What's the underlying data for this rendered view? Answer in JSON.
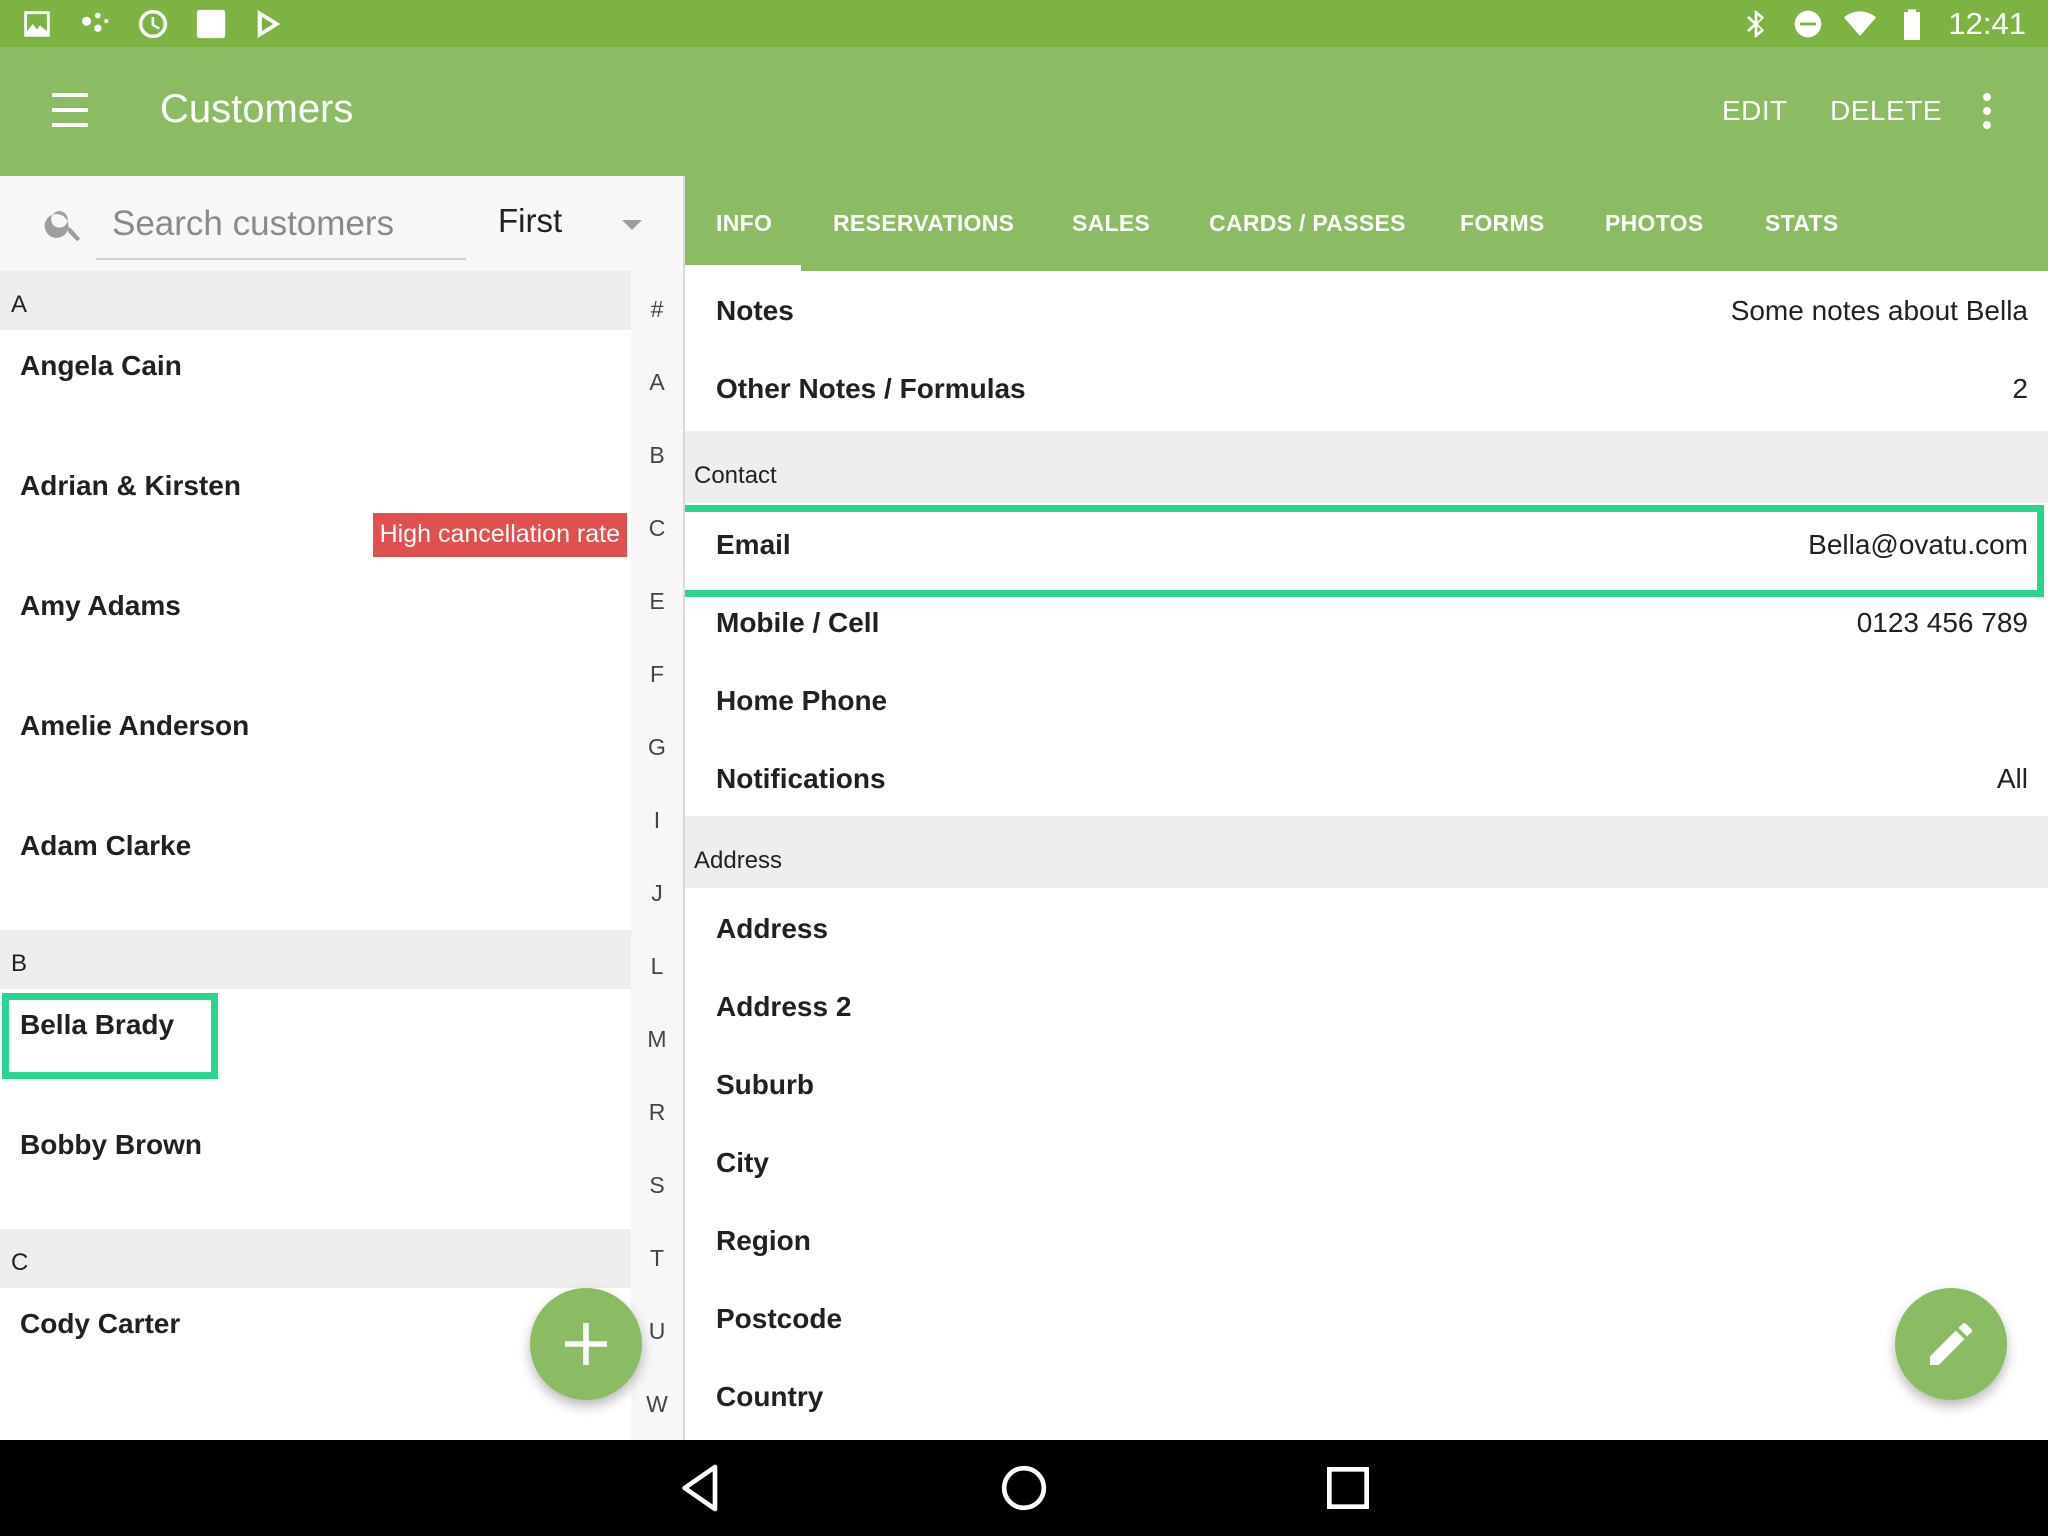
{
  "status_bar": {
    "time": "12:41"
  },
  "app_bar": {
    "title": "Customers",
    "edit_label": "EDIT",
    "delete_label": "DELETE"
  },
  "search": {
    "placeholder": "Search customers",
    "sort_value": "First"
  },
  "customer_list": {
    "sections": [
      {
        "letter": "A",
        "customers": [
          {
            "name": "Angela Cain"
          },
          {
            "name": "Adrian & Kirsten",
            "badge": "High cancellation rate"
          },
          {
            "name": "Amy Adams"
          },
          {
            "name": "Amelie Anderson"
          },
          {
            "name": "Adam Clarke"
          }
        ]
      },
      {
        "letter": "B",
        "customers": [
          {
            "name": "Bella Brady"
          },
          {
            "name": "Bobby Brown"
          }
        ]
      },
      {
        "letter": "C",
        "customers": [
          {
            "name": "Cody Carter"
          }
        ]
      }
    ]
  },
  "alpha_index": [
    "#",
    "A",
    "B",
    "C",
    "E",
    "F",
    "G",
    "I",
    "J",
    "L",
    "M",
    "R",
    "S",
    "T",
    "U",
    "W"
  ],
  "tabs": [
    "INFO",
    "RESERVATIONS",
    "SALES",
    "CARDS / PASSES",
    "FORMS",
    "PHOTOS",
    "STATS"
  ],
  "details": {
    "notes": {
      "label": "Notes",
      "value": "Some notes about Bella"
    },
    "other_notes": {
      "label": "Other Notes / Formulas",
      "value": "2"
    },
    "contact_section": "Contact",
    "email": {
      "label": "Email",
      "value": "Bella@ovatu.com"
    },
    "mobile": {
      "label": "Mobile / Cell",
      "value": "0123 456 789"
    },
    "home_phone": {
      "label": "Home Phone"
    },
    "notifications": {
      "label": "Notifications",
      "value": "All"
    },
    "address_section": "Address",
    "address": {
      "label": "Address"
    },
    "address2": {
      "label": "Address 2"
    },
    "suburb": {
      "label": "Suburb"
    },
    "city": {
      "label": "City"
    },
    "region": {
      "label": "Region"
    },
    "postcode": {
      "label": "Postcode"
    },
    "country": {
      "label": "Country"
    }
  },
  "colors": {
    "status_bar": "#7cb342",
    "app_bar": "#8bbb63",
    "highlight": "#2bd58f",
    "badge": "#e0504f"
  }
}
